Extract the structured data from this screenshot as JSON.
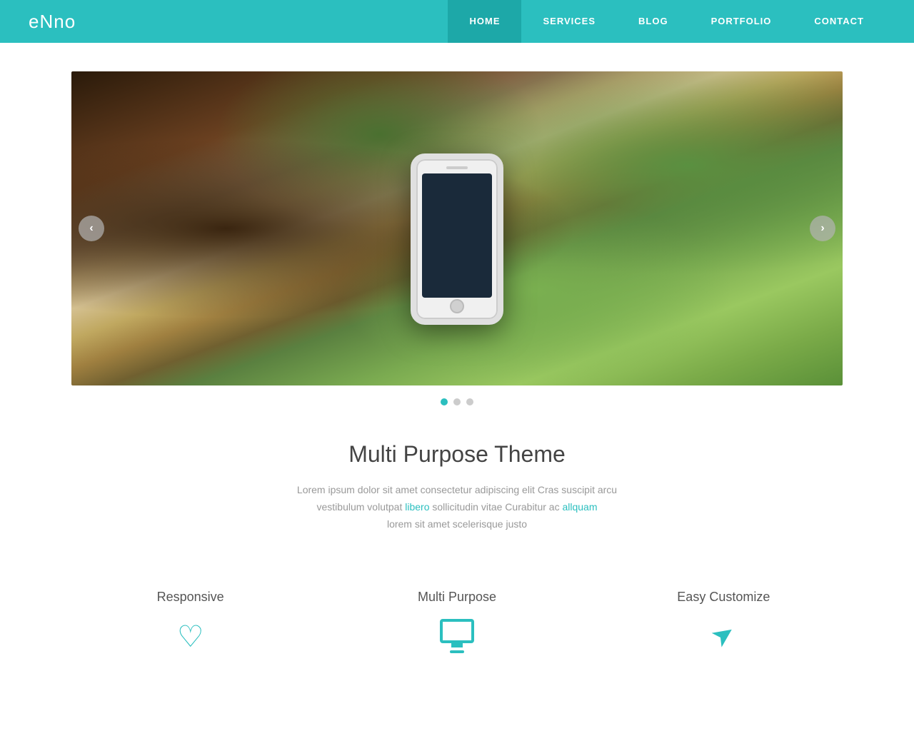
{
  "nav": {
    "logo": "eNno",
    "links": [
      {
        "id": "home",
        "label": "HOME",
        "active": true
      },
      {
        "id": "services",
        "label": "SERVICES",
        "active": false
      },
      {
        "id": "blog",
        "label": "BLOG",
        "active": false
      },
      {
        "id": "portfolio",
        "label": "PORTFOLIO",
        "active": false
      },
      {
        "id": "contact",
        "label": "CONTACT",
        "active": false
      }
    ]
  },
  "slider": {
    "prev_label": "‹",
    "next_label": "›",
    "dots": [
      {
        "id": "dot1",
        "active": true
      },
      {
        "id": "dot2",
        "active": false
      },
      {
        "id": "dot3",
        "active": false
      }
    ]
  },
  "main_content": {
    "title": "Multi Purpose Theme",
    "description_line1": "Lorem ipsum dolor sit amet consectetur adipiscing elit Cras suscipit arcu",
    "description_line2": "vestibulum volutpat libero sollicitudin vitae Curabitur ac allquam",
    "description_line3": "lorem sit amet scelerisque justo"
  },
  "features": [
    {
      "id": "responsive",
      "title": "Responsive",
      "icon": "heart"
    },
    {
      "id": "multi-purpose",
      "title": "Multi Purpose",
      "icon": "monitor"
    },
    {
      "id": "easy-customize",
      "title": "Easy Customize",
      "icon": "send"
    }
  ]
}
